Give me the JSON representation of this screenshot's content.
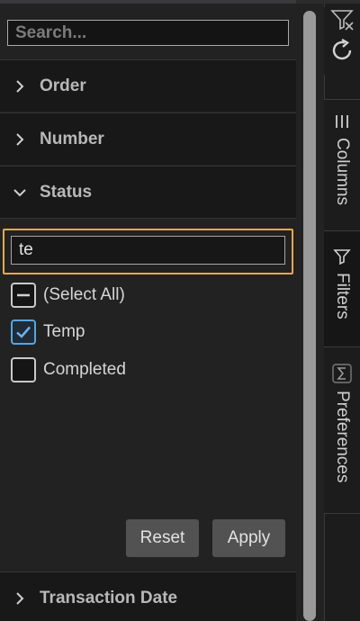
{
  "search": {
    "placeholder": "Search..."
  },
  "groups": {
    "order": {
      "label": "Order"
    },
    "number": {
      "label": "Number"
    },
    "status": {
      "label": "Status"
    },
    "transaction_date": {
      "label": "Transaction Date"
    }
  },
  "status_filter": {
    "mini_filter_value": "te",
    "options": [
      {
        "label": "(Select All)",
        "state": "indeterminate"
      },
      {
        "label": "Temp",
        "state": "checked"
      },
      {
        "label": "Completed",
        "state": "unchecked"
      }
    ],
    "reset_label": "Reset",
    "apply_label": "Apply"
  },
  "side_tabs": {
    "columns": {
      "label": "Columns",
      "icon": "columns-icon"
    },
    "filters": {
      "label": "Filters",
      "icon": "funnel-icon"
    },
    "preferences": {
      "label": "Preferences",
      "icon": "sigma-icon"
    }
  },
  "colors": {
    "focus_outline": "#e8a94b",
    "check_accent": "#5aa4e0"
  }
}
